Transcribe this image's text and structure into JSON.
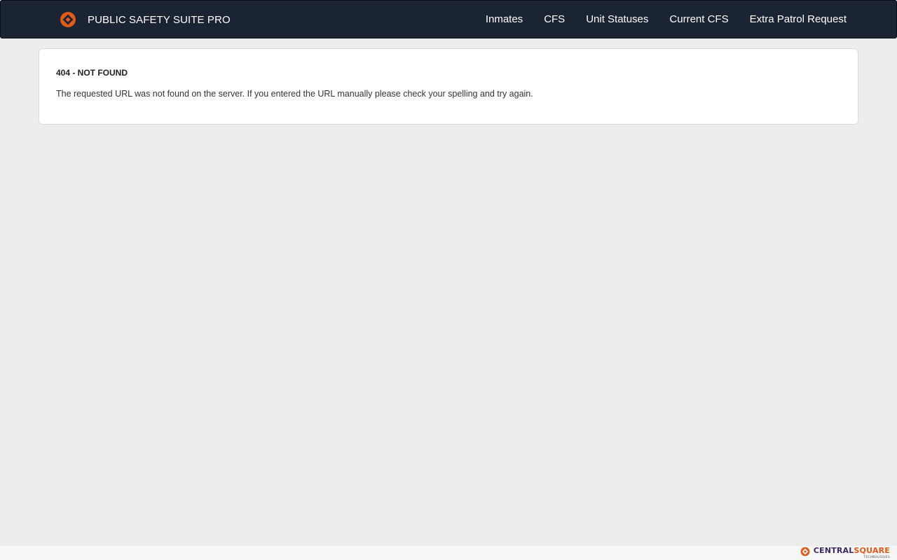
{
  "app": {
    "title": "PUBLIC SAFETY SUITE PRO"
  },
  "nav": {
    "items": [
      {
        "label": "Inmates"
      },
      {
        "label": "CFS"
      },
      {
        "label": "Unit Statuses"
      },
      {
        "label": "Current CFS"
      },
      {
        "label": "Extra Patrol Request"
      }
    ]
  },
  "error": {
    "title": "404 - NOT FOUND",
    "message": "The requested URL was not found on the server. If you entered the URL manually please check your spelling and try again."
  },
  "footer": {
    "brand_part1": "CENTRAL",
    "brand_part2": "SQUARE",
    "brand_sub": "TECHNOLOGIES"
  },
  "colors": {
    "navbar_bg": "#1b2433",
    "accent_orange": "#e25a17",
    "page_bg": "#ededed",
    "brand_purple": "#3b2a63"
  },
  "icons": {
    "brand_logo": "centralsquare-logo-icon",
    "footer_logo": "centralsquare-logo-icon"
  }
}
